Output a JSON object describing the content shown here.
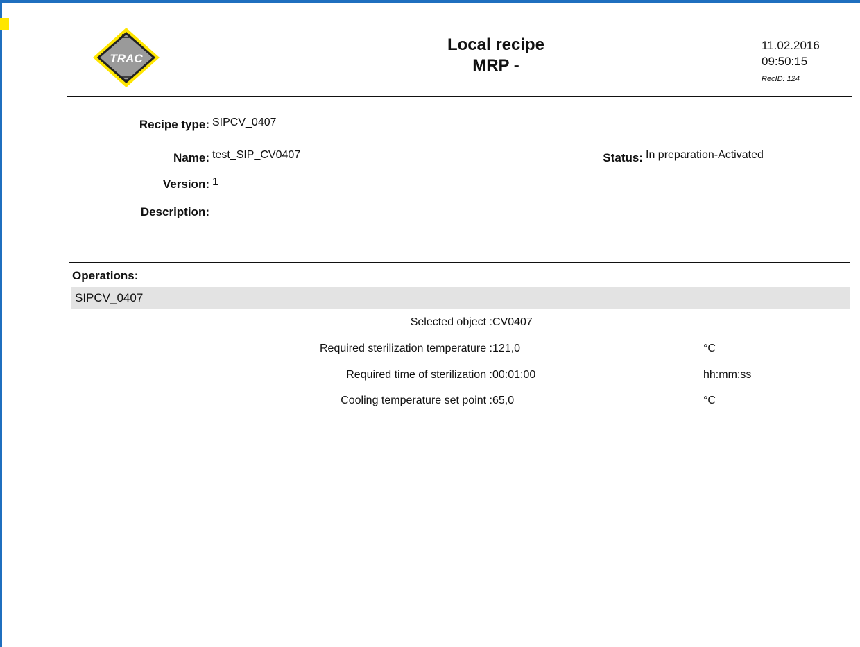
{
  "header": {
    "logo_text": "TRAC",
    "title_line1": "Local recipe",
    "title_line2": "MRP -",
    "date": "11.02.2016",
    "time": "09:50:15",
    "rec_id": "RecID: 124"
  },
  "recipe": {
    "type_label": "Recipe type:",
    "type_value": "SIPCV_0407",
    "name_label": "Name:",
    "name_value": "test_SIP_CV0407",
    "version_label": "Version:",
    "version_value": "1",
    "description_label": "Description:",
    "description_value": "",
    "status_label": "Status:",
    "status_value": "In preparation-Activated"
  },
  "operations": {
    "title": "Operations:",
    "name": "SIPCV_0407",
    "params": [
      {
        "label": "Selected object :",
        "value": "CV0407",
        "unit": ""
      },
      {
        "label": "Required sterilization temperature :",
        "value": "121,0",
        "unit": "°C"
      },
      {
        "label": "Required time of sterilization :",
        "value": "00:01:00",
        "unit": "hh:mm:ss"
      },
      {
        "label": "Cooling temperature set point :",
        "value": "65,0",
        "unit": "°C"
      }
    ]
  },
  "colors": {
    "frame": "#1f6fbf",
    "logo_yellow": "#ffe600",
    "logo_grey": "#9a9a9a",
    "ops_bar": "#e3e3e3"
  }
}
